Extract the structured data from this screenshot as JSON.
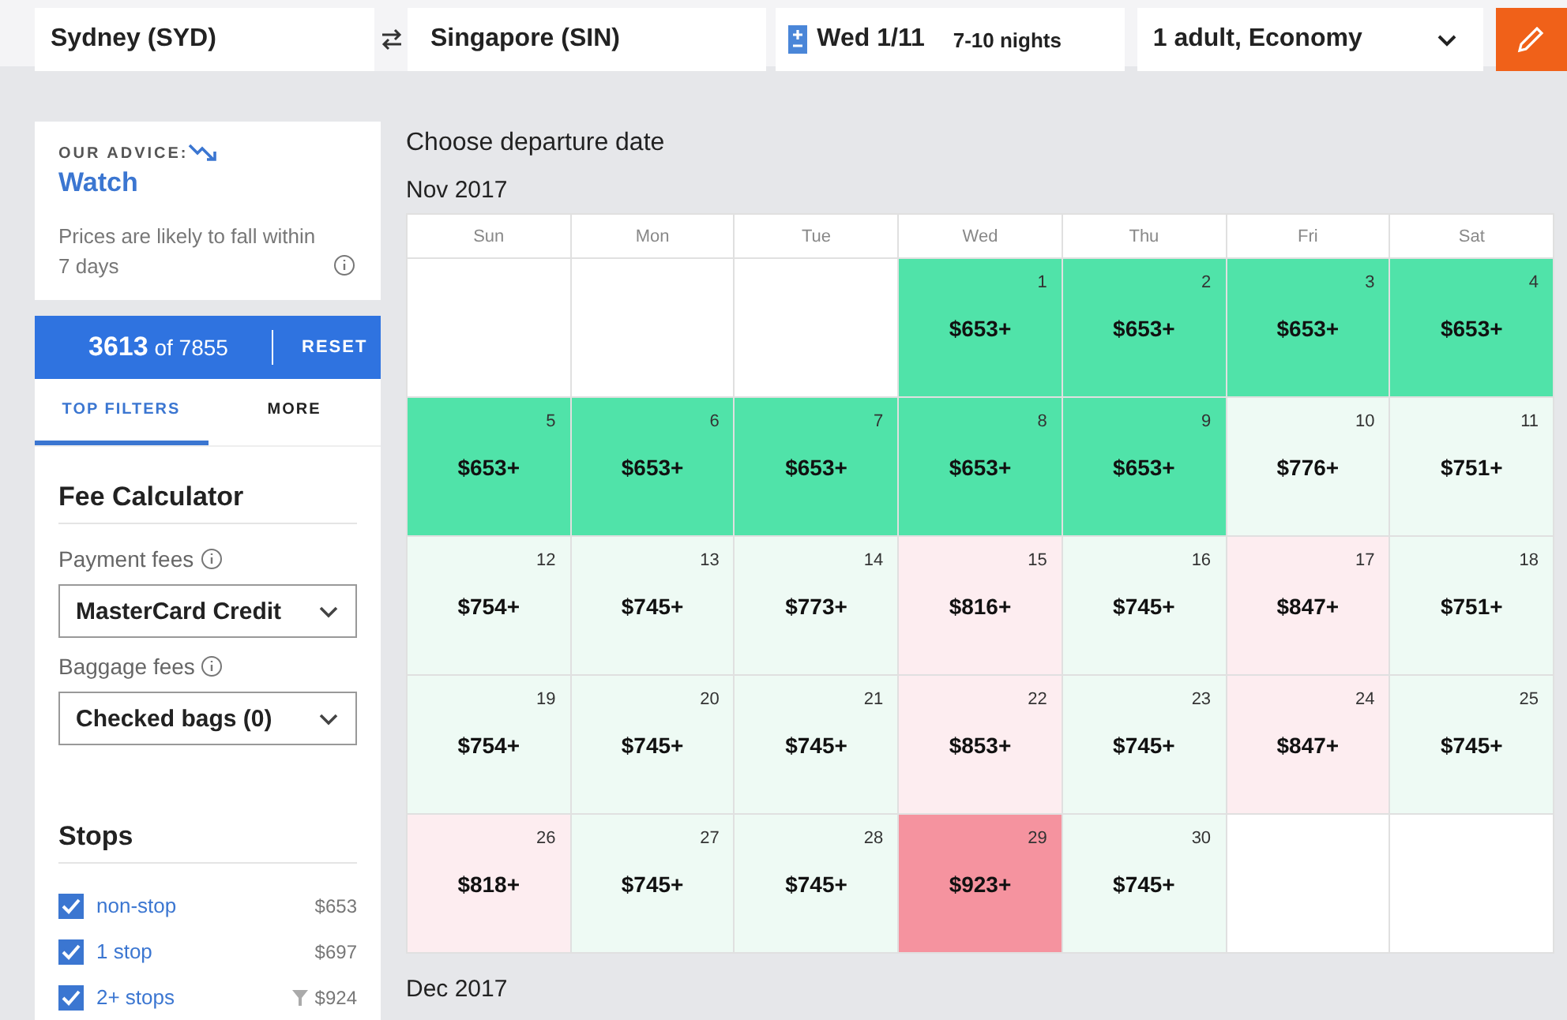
{
  "search": {
    "origin": "Sydney (SYD)",
    "destination": "Singapore (SIN)",
    "date": "Wed 1/11",
    "nights": "7-10 nights",
    "travellers": "1 adult, Economy"
  },
  "advice": {
    "label": "OUR ADVICE:",
    "verdict": "Watch",
    "text": "Prices are likely to fall within 7 days"
  },
  "results": {
    "count": "3613",
    "of": "of 7855",
    "reset": "RESET"
  },
  "tabs": [
    {
      "label": "TOP FILTERS",
      "selected": true
    },
    {
      "label": "MORE",
      "selected": false
    }
  ],
  "fees": {
    "title": "Fee Calculator",
    "payment_label": "Payment fees",
    "payment_value": "MasterCard Credit",
    "baggage_label": "Baggage fees",
    "baggage_value": "Checked bags (0)"
  },
  "stops": {
    "title": "Stops",
    "items": [
      {
        "label": "non-stop",
        "price": "$653",
        "checked": true,
        "filter_icon": false
      },
      {
        "label": "1 stop",
        "price": "$697",
        "checked": true,
        "filter_icon": false
      },
      {
        "label": "2+ stops",
        "price": "$924",
        "checked": true,
        "filter_icon": true
      }
    ]
  },
  "calendar": {
    "title": "Choose departure date",
    "month": "Nov 2017",
    "weekdays": [
      "Sun",
      "Mon",
      "Tue",
      "Wed",
      "Thu",
      "Fri",
      "Sat"
    ],
    "weeks": [
      [
        {
          "kind": "empty"
        },
        {
          "kind": "empty"
        },
        {
          "kind": "empty"
        },
        {
          "kind": "day",
          "day": "1",
          "price": "$653+",
          "color": "#50e3a9"
        },
        {
          "kind": "day",
          "day": "2",
          "price": "$653+",
          "color": "#50e3a9"
        },
        {
          "kind": "day",
          "day": "3",
          "price": "$653+",
          "color": "#50e3a9"
        },
        {
          "kind": "day",
          "day": "4",
          "price": "$653+",
          "color": "#50e3a9"
        }
      ],
      [
        {
          "kind": "day",
          "day": "5",
          "price": "$653+",
          "color": "#50e3a9"
        },
        {
          "kind": "day",
          "day": "6",
          "price": "$653+",
          "color": "#50e3a9"
        },
        {
          "kind": "day",
          "day": "7",
          "price": "$653+",
          "color": "#50e3a9"
        },
        {
          "kind": "day",
          "day": "8",
          "price": "$653+",
          "color": "#50e3a9"
        },
        {
          "kind": "day",
          "day": "9",
          "price": "$653+",
          "color": "#50e3a9"
        },
        {
          "kind": "day",
          "day": "10",
          "price": "$776+",
          "color": "#eefaf4"
        },
        {
          "kind": "day",
          "day": "11",
          "price": "$751+",
          "color": "#eefaf4"
        }
      ],
      [
        {
          "kind": "day",
          "day": "12",
          "price": "$754+",
          "color": "#eefaf4"
        },
        {
          "kind": "day",
          "day": "13",
          "price": "$745+",
          "color": "#eefaf4"
        },
        {
          "kind": "day",
          "day": "14",
          "price": "$773+",
          "color": "#eefaf4"
        },
        {
          "kind": "day",
          "day": "15",
          "price": "$816+",
          "color": "#fdedf0"
        },
        {
          "kind": "day",
          "day": "16",
          "price": "$745+",
          "color": "#eefaf4"
        },
        {
          "kind": "day",
          "day": "17",
          "price": "$847+",
          "color": "#fdedf0"
        },
        {
          "kind": "day",
          "day": "18",
          "price": "$751+",
          "color": "#eefaf4"
        }
      ],
      [
        {
          "kind": "day",
          "day": "19",
          "price": "$754+",
          "color": "#eefaf4"
        },
        {
          "kind": "day",
          "day": "20",
          "price": "$745+",
          "color": "#eefaf4"
        },
        {
          "kind": "day",
          "day": "21",
          "price": "$745+",
          "color": "#eefaf4"
        },
        {
          "kind": "day",
          "day": "22",
          "price": "$853+",
          "color": "#fdedf0"
        },
        {
          "kind": "day",
          "day": "23",
          "price": "$745+",
          "color": "#eefaf4"
        },
        {
          "kind": "day",
          "day": "24",
          "price": "$847+",
          "color": "#fdedf0"
        },
        {
          "kind": "day",
          "day": "25",
          "price": "$745+",
          "color": "#eefaf4"
        }
      ],
      [
        {
          "kind": "day",
          "day": "26",
          "price": "$818+",
          "color": "#fdedf0"
        },
        {
          "kind": "day",
          "day": "27",
          "price": "$745+",
          "color": "#eefaf4"
        },
        {
          "kind": "day",
          "day": "28",
          "price": "$745+",
          "color": "#eefaf4"
        },
        {
          "kind": "day",
          "day": "29",
          "price": "$923+",
          "color": "#f5939f"
        },
        {
          "kind": "day",
          "day": "30",
          "price": "$745+",
          "color": "#eefaf4"
        },
        {
          "kind": "empty"
        },
        {
          "kind": "empty"
        }
      ]
    ],
    "next_month": "Dec 2017"
  }
}
